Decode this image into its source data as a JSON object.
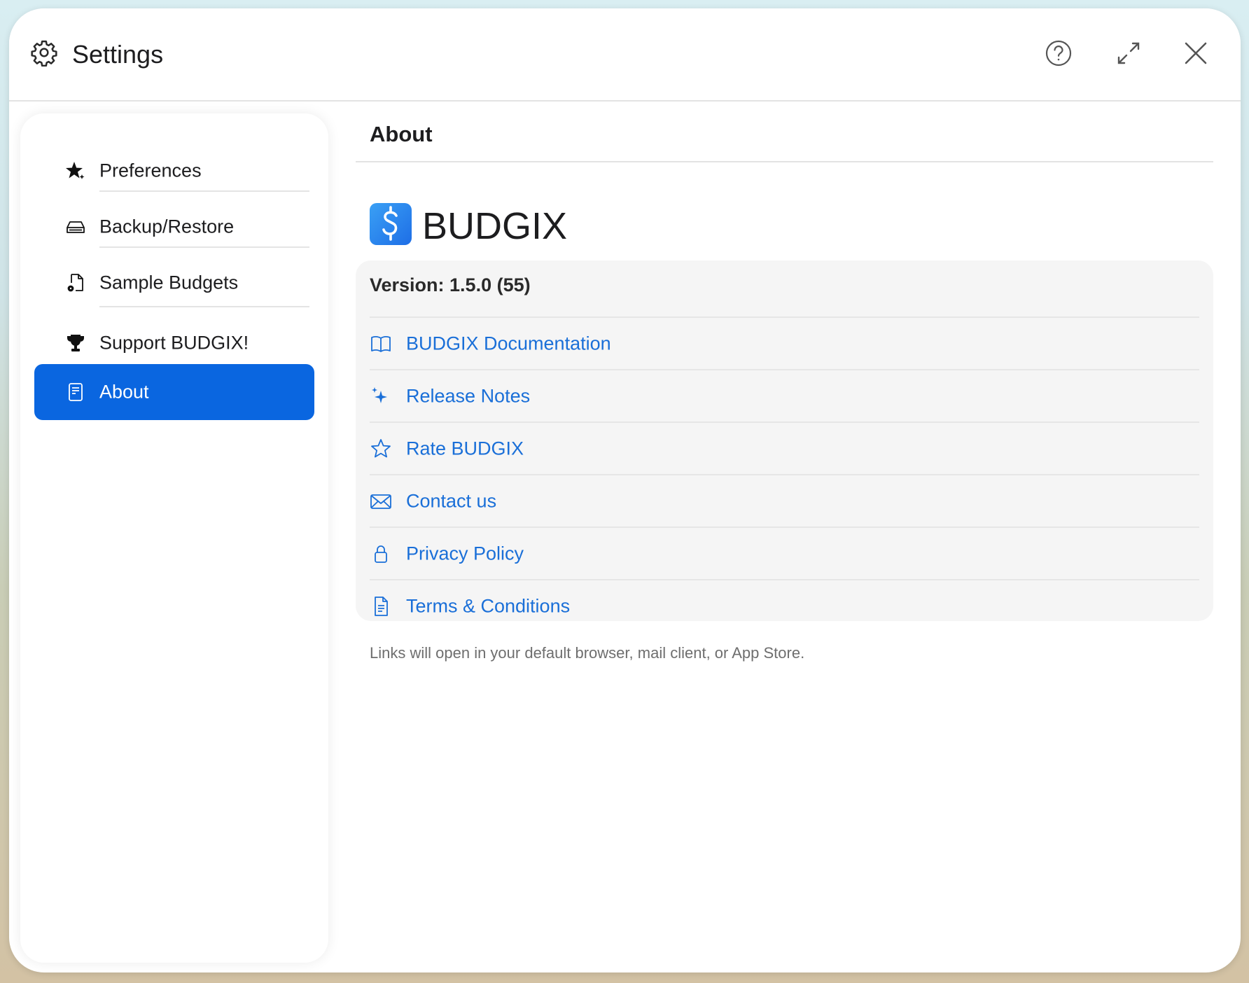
{
  "window": {
    "title": "Settings",
    "icons": {
      "title": "gear-icon",
      "help": "question-circle-icon",
      "expand": "expand-arrows-icon",
      "close": "close-icon"
    }
  },
  "sidebar": {
    "items": [
      {
        "label": "Preferences",
        "icon": "star-sparkle-icon"
      },
      {
        "label": "Backup/Restore",
        "icon": "drive-icon"
      },
      {
        "label": "Sample Budgets",
        "icon": "document-gear-icon"
      },
      {
        "label": "Support BUDGIX!",
        "icon": "trophy-icon"
      },
      {
        "label": "About",
        "icon": "notepad-icon",
        "selected": true
      }
    ],
    "accent": "#0a66e0"
  },
  "main": {
    "title": "About",
    "app_name": "BUDGIX",
    "app_logo_icon": "dollar-icon",
    "version": "Version: 1.5.0 (55)",
    "links": [
      {
        "label": "BUDGIX Documentation",
        "icon": "book-icon"
      },
      {
        "label": "Release Notes",
        "icon": "sparkles-icon"
      },
      {
        "label": "Rate BUDGIX",
        "icon": "star-outline-icon"
      },
      {
        "label": "Contact us",
        "icon": "envelope-icon"
      },
      {
        "label": "Privacy Policy",
        "icon": "lock-icon"
      },
      {
        "label": "Terms & Conditions",
        "icon": "document-icon"
      }
    ],
    "link_color": "#1a6fd8",
    "footnote": "Links will open in your default browser, mail client, or App Store."
  }
}
